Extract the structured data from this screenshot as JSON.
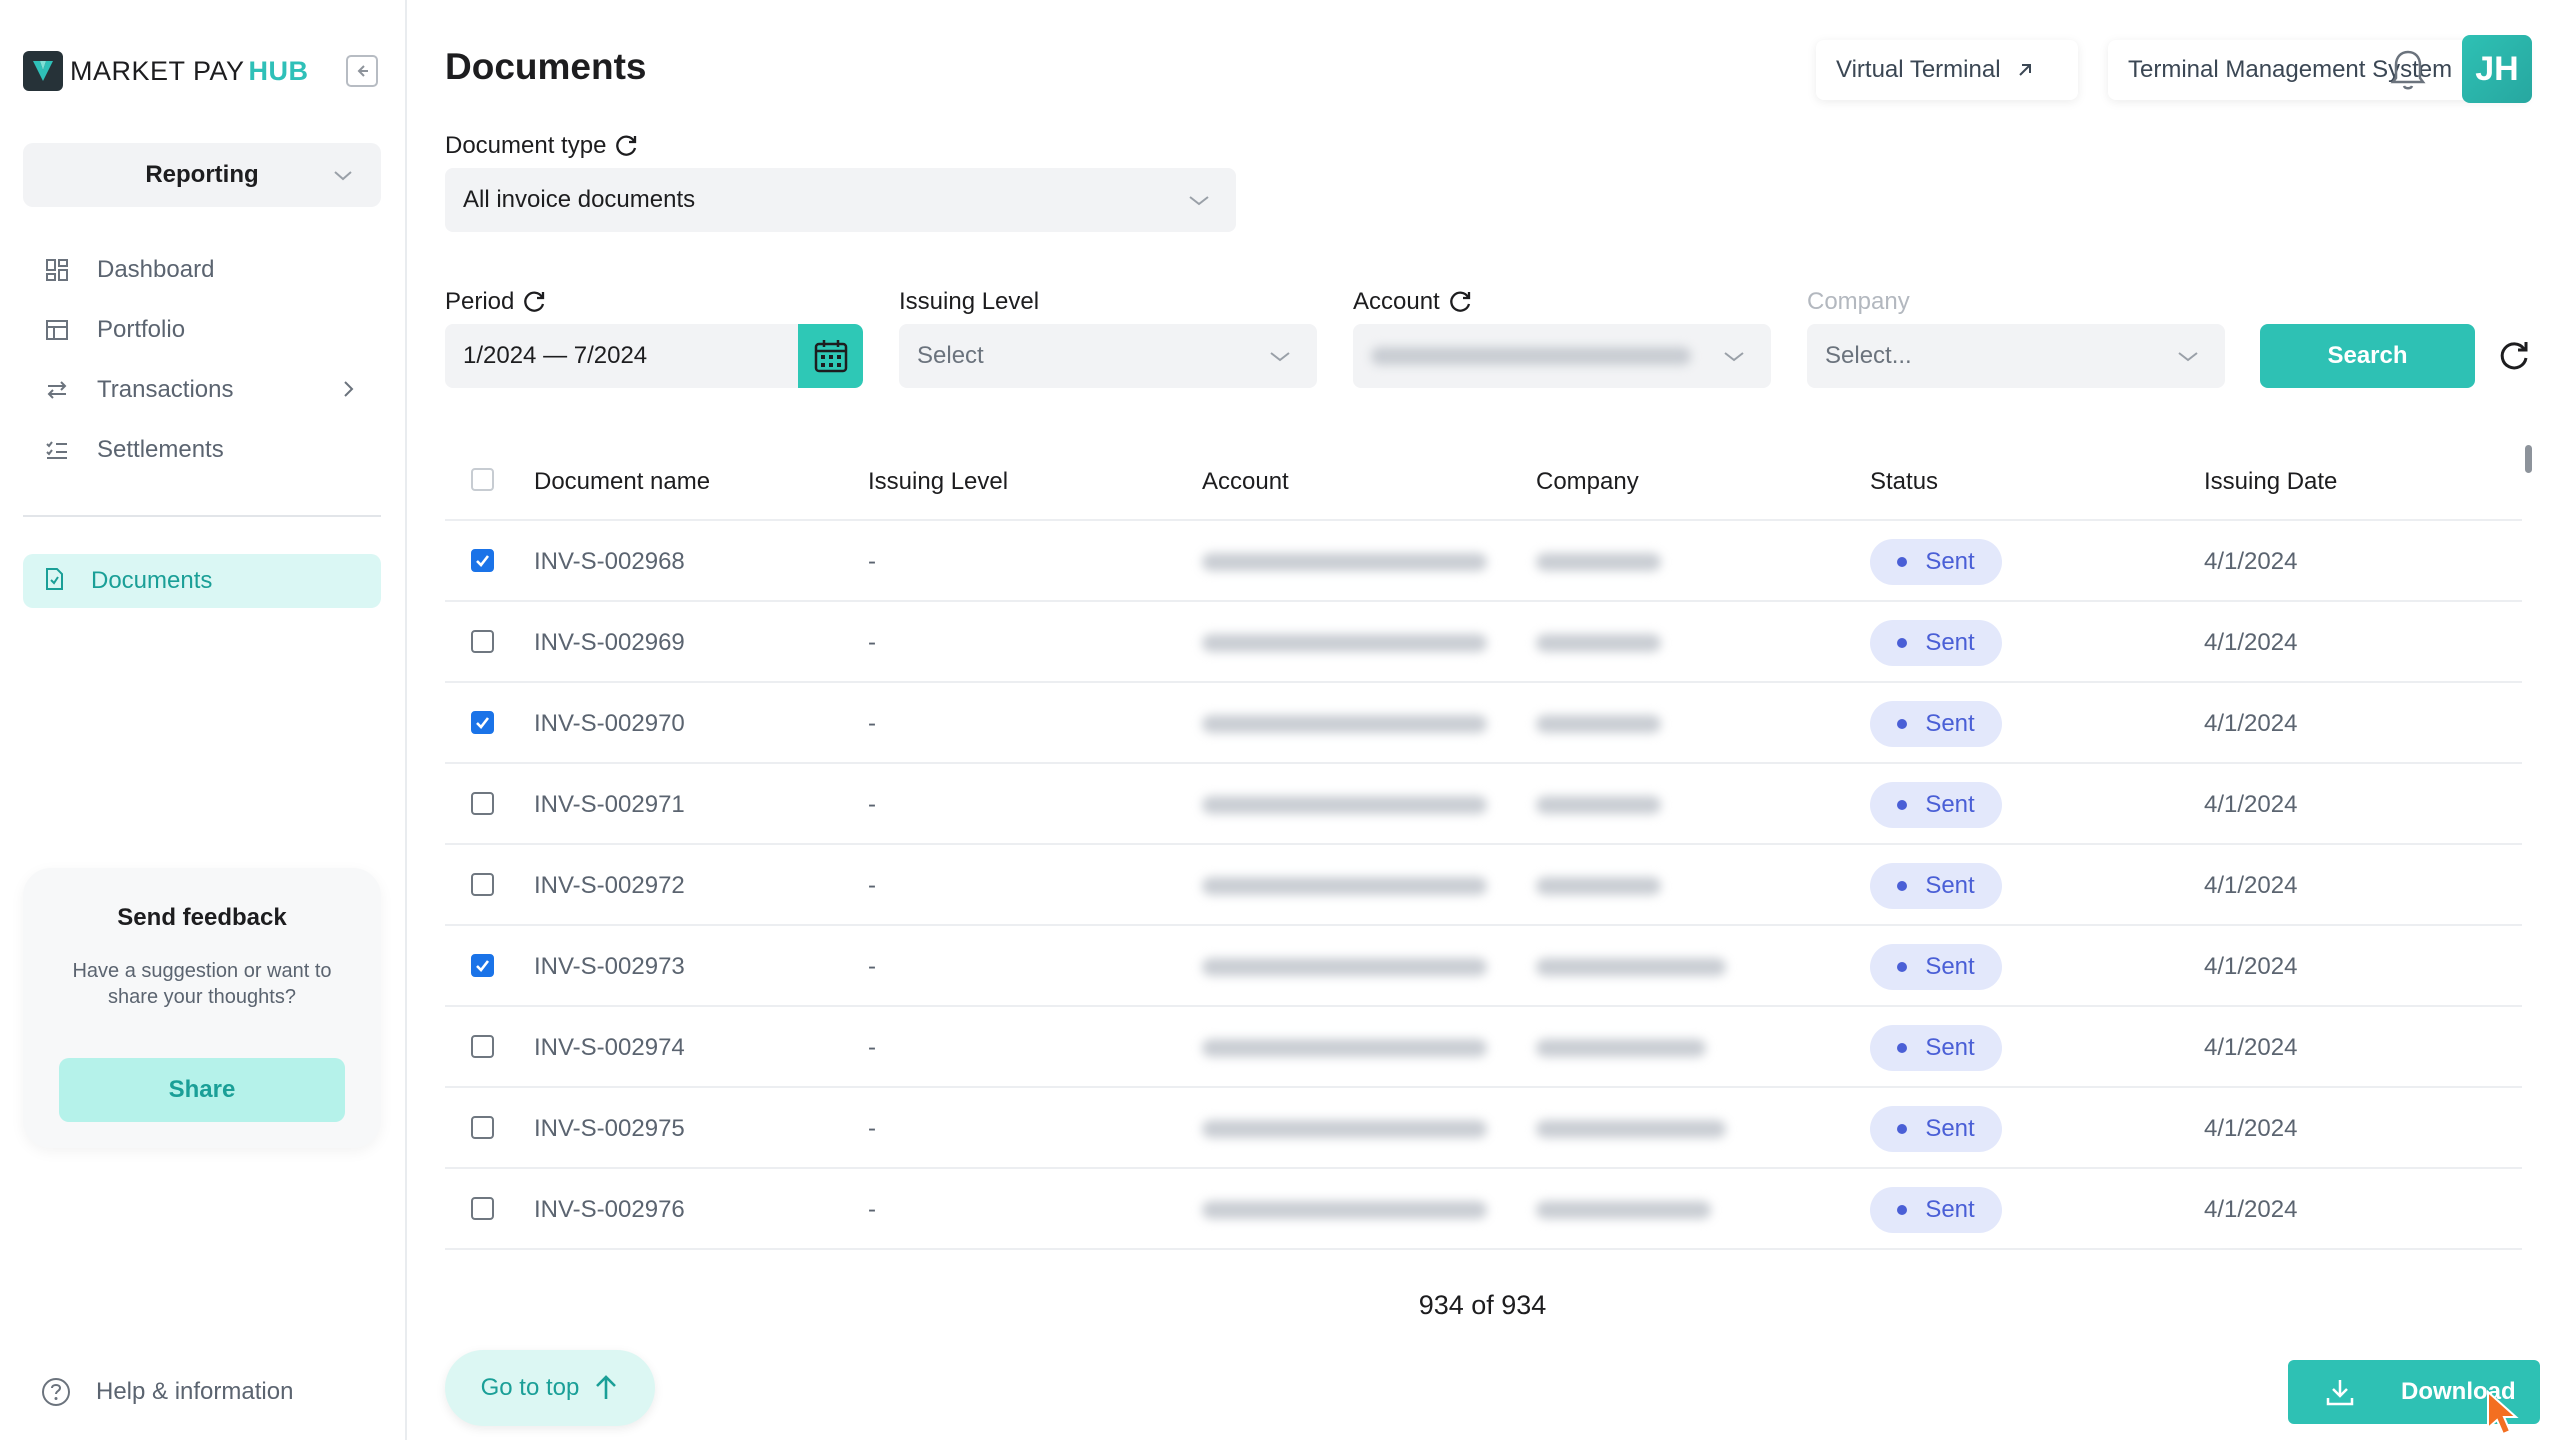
{
  "brand": {
    "name": "MARKET PAY",
    "hub": "HUB"
  },
  "sidebar": {
    "module": "Reporting",
    "items": [
      {
        "label": "Dashboard",
        "icon": "dashboard-icon"
      },
      {
        "label": "Portfolio",
        "icon": "portfolio-icon"
      },
      {
        "label": "Transactions",
        "icon": "transactions-icon",
        "has_submenu": true
      },
      {
        "label": "Settlements",
        "icon": "settlements-icon"
      }
    ],
    "active_item": {
      "label": "Documents",
      "icon": "document-icon"
    },
    "feedback": {
      "title": "Send feedback",
      "text": "Have a suggestion or want to share your thoughts?",
      "button": "Share"
    },
    "help": "Help & information"
  },
  "header": {
    "title": "Documents",
    "links": [
      "Virtual Terminal",
      "Terminal Management System"
    ],
    "avatar_initials": "JH"
  },
  "filters": {
    "document_type": {
      "label": "Document type",
      "value": "All invoice documents"
    },
    "period": {
      "label": "Period",
      "value": "1/2024 — 7/2024"
    },
    "issuing_level": {
      "label": "Issuing Level",
      "placeholder": "Select"
    },
    "account": {
      "label": "Account",
      "value": ""
    },
    "company": {
      "label": "Company",
      "placeholder": "Select..."
    },
    "search_button": "Search"
  },
  "table": {
    "columns": [
      "Document name",
      "Issuing Level",
      "Account",
      "Company",
      "Status",
      "Issuing Date"
    ],
    "rows": [
      {
        "checked": true,
        "name": "INV-S-002968",
        "level": "-",
        "status": "Sent",
        "date": "4/1/2024"
      },
      {
        "checked": false,
        "name": "INV-S-002969",
        "level": "-",
        "status": "Sent",
        "date": "4/1/2024"
      },
      {
        "checked": true,
        "name": "INV-S-002970",
        "level": "-",
        "status": "Sent",
        "date": "4/1/2024"
      },
      {
        "checked": false,
        "name": "INV-S-002971",
        "level": "-",
        "status": "Sent",
        "date": "4/1/2024"
      },
      {
        "checked": false,
        "name": "INV-S-002972",
        "level": "-",
        "status": "Sent",
        "date": "4/1/2024"
      },
      {
        "checked": true,
        "name": "INV-S-002973",
        "level": "-",
        "status": "Sent",
        "date": "4/1/2024"
      },
      {
        "checked": false,
        "name": "INV-S-002974",
        "level": "-",
        "status": "Sent",
        "date": "4/1/2024"
      },
      {
        "checked": false,
        "name": "INV-S-002975",
        "level": "-",
        "status": "Sent",
        "date": "4/1/2024"
      },
      {
        "checked": false,
        "name": "INV-S-002976",
        "level": "-",
        "status": "Sent",
        "date": "4/1/2024"
      }
    ]
  },
  "pagination": {
    "text": "934 of 934"
  },
  "actions": {
    "go_to_top": "Go to top",
    "download": "Download"
  },
  "colors": {
    "accent": "#2ec1b4",
    "accent_light": "#daf7f4",
    "status_badge": "#e3e8fb",
    "status_text": "#4a5fd6",
    "checkbox": "#1a73e8"
  }
}
